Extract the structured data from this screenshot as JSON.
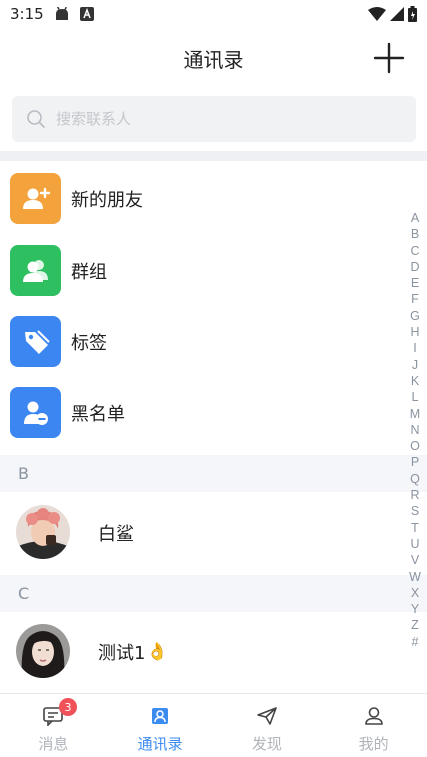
{
  "status_bar": {
    "time": "3:15"
  },
  "header": {
    "title": "通讯录"
  },
  "search": {
    "placeholder": "搜索联系人"
  },
  "functions": [
    {
      "label": "新的朋友",
      "icon": "add-friend-icon",
      "color": "#f4a23c"
    },
    {
      "label": "群组",
      "icon": "group-icon",
      "color": "#2dbf60"
    },
    {
      "label": "标签",
      "icon": "tag-icon",
      "color": "#3b86f0"
    },
    {
      "label": "黑名单",
      "icon": "blacklist-icon",
      "color": "#3b86f0"
    }
  ],
  "sections": [
    {
      "letter": "B",
      "contacts": [
        {
          "name": "白鲨",
          "emoji": ""
        }
      ]
    },
    {
      "letter": "C",
      "contacts": [
        {
          "name": "测试1",
          "emoji": "👌"
        }
      ]
    }
  ],
  "index_letters": [
    "A",
    "B",
    "C",
    "D",
    "E",
    "F",
    "G",
    "H",
    "I",
    "J",
    "K",
    "L",
    "M",
    "N",
    "O",
    "P",
    "Q",
    "R",
    "S",
    "T",
    "U",
    "V",
    "W",
    "X",
    "Y",
    "Z",
    "#"
  ],
  "tabs": [
    {
      "label": "消息",
      "icon": "message-icon",
      "badge": "3",
      "active": false
    },
    {
      "label": "通讯录",
      "icon": "contacts-icon",
      "badge": "",
      "active": true
    },
    {
      "label": "发现",
      "icon": "discover-icon",
      "badge": "",
      "active": false
    },
    {
      "label": "我的",
      "icon": "profile-icon",
      "badge": "",
      "active": false
    }
  ],
  "colors": {
    "accent": "#3c8cf0",
    "badge": "#f0525a",
    "inactive": "#b0b4ba"
  }
}
